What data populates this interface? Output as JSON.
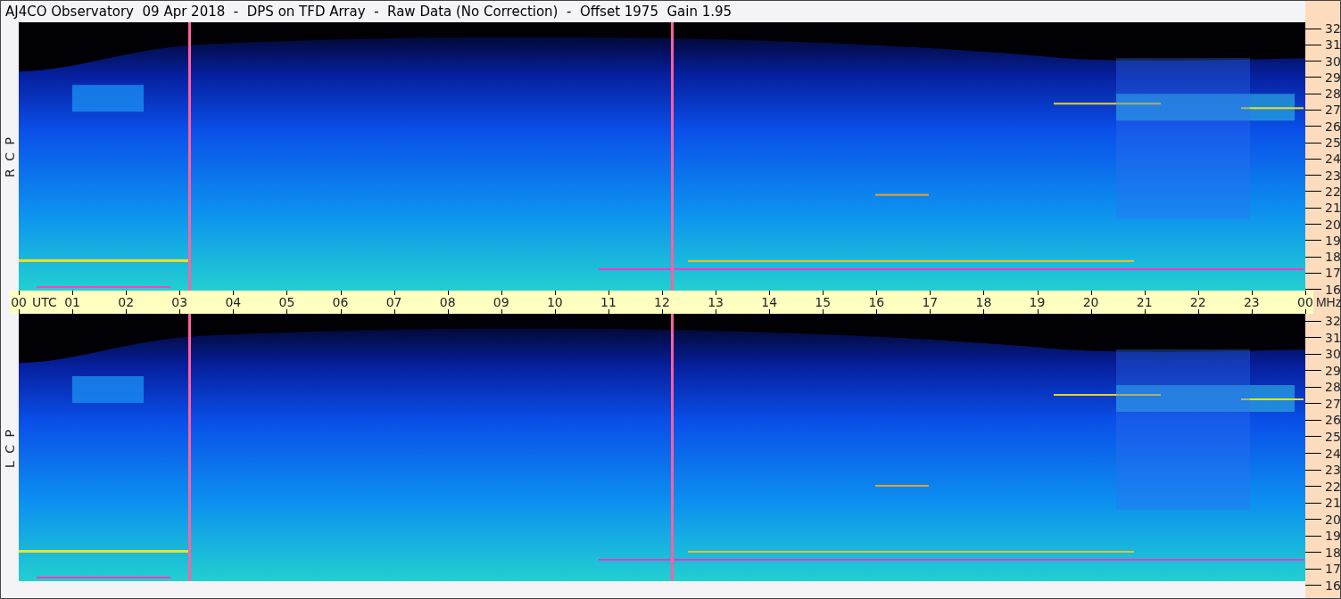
{
  "title": "AJ4CO Observatory  09 Apr 2018  -  DPS on TFD Array  -  Raw Data (No Correction)  -  Offset 1975  Gain 1.95",
  "panels": [
    {
      "label": "R C P",
      "frequency_ticks": [
        "32",
        "31",
        "30",
        "29",
        "28",
        "27",
        "26",
        "25",
        "24",
        "23",
        "22",
        "21",
        "20",
        "19",
        "18",
        "17",
        "16"
      ]
    },
    {
      "label": "L C P",
      "frequency_ticks": [
        "32",
        "31",
        "30",
        "29",
        "28",
        "27",
        "26",
        "25",
        "24",
        "23",
        "22",
        "21",
        "20",
        "19",
        "18",
        "17",
        "16"
      ]
    }
  ],
  "time_axis": {
    "ticks": [
      "00",
      "01",
      "02",
      "03",
      "04",
      "05",
      "06",
      "07",
      "08",
      "09",
      "10",
      "11",
      "12",
      "13",
      "14",
      "15",
      "16",
      "17",
      "18",
      "19",
      "20",
      "21",
      "22",
      "23",
      "00"
    ],
    "zone": "UTC",
    "unit": "MHz"
  }
}
